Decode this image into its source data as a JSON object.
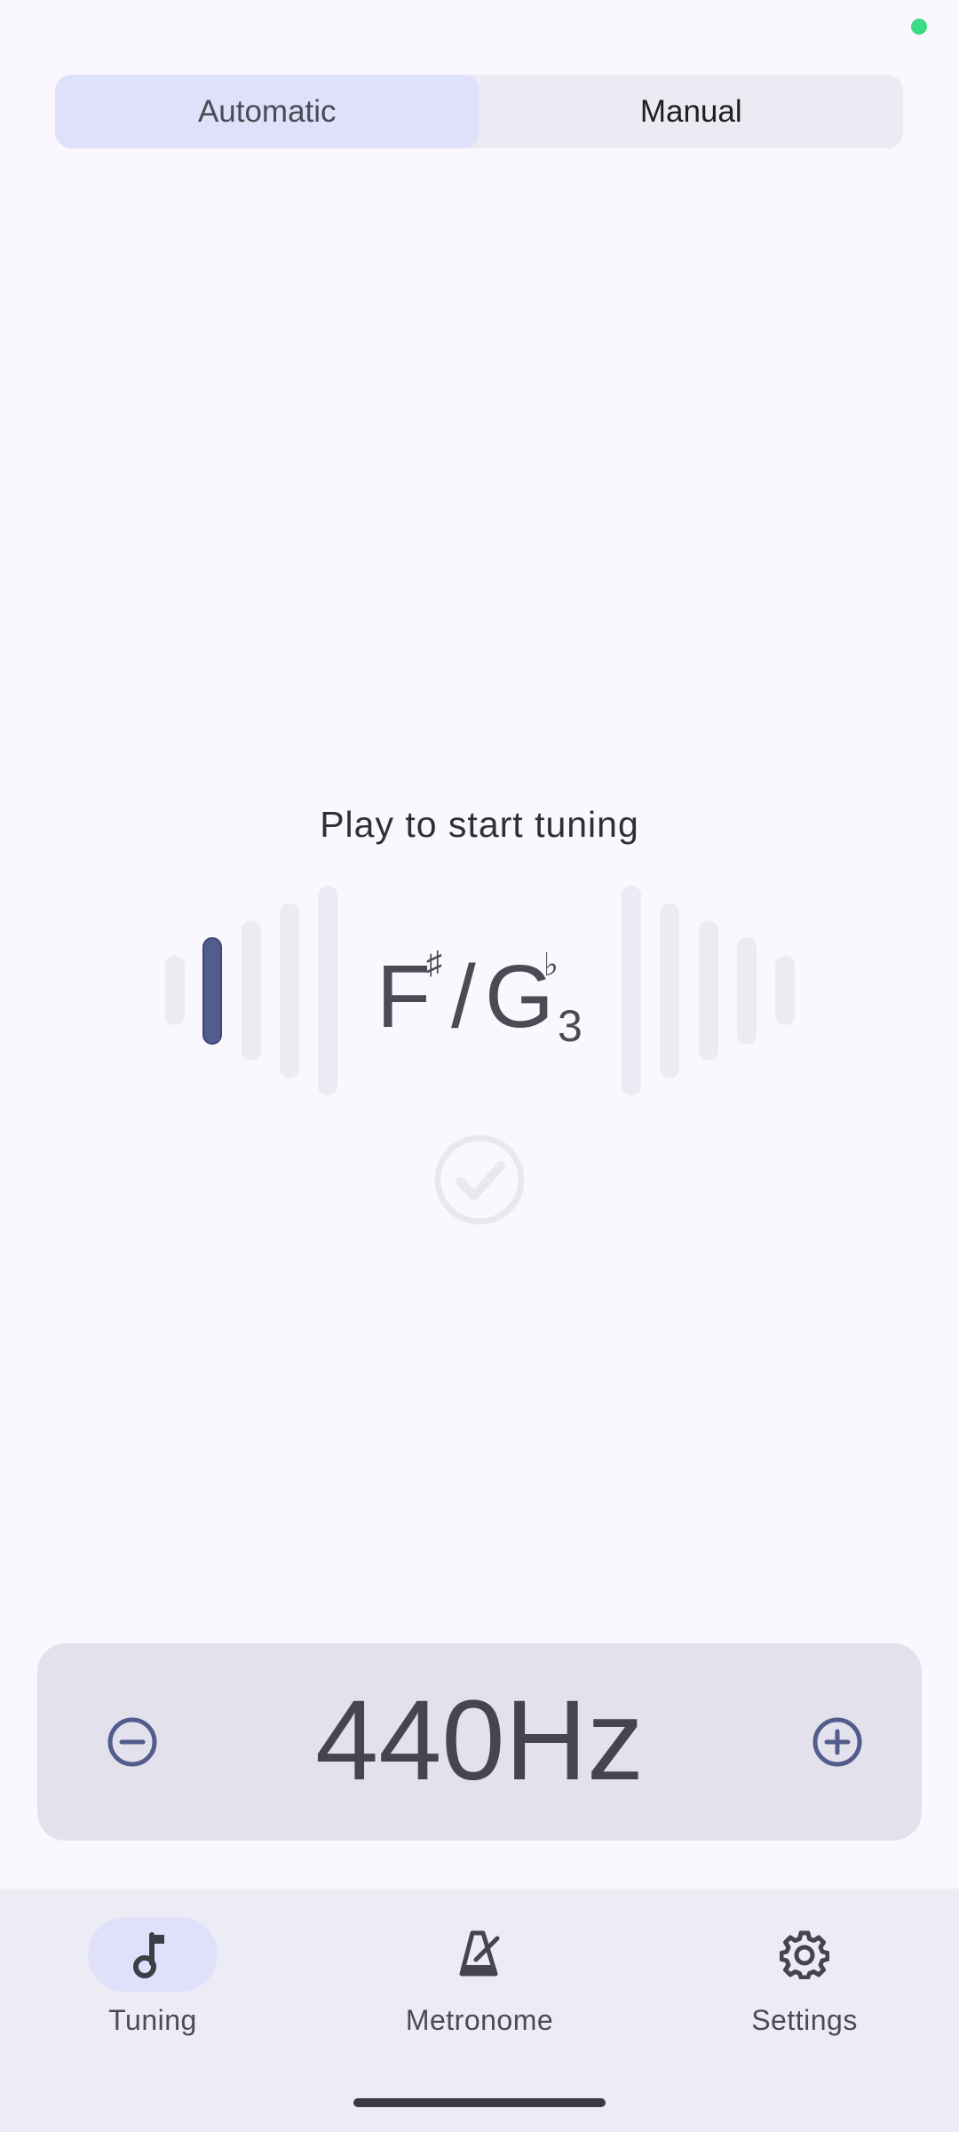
{
  "mode_toggle": {
    "options": [
      {
        "label": "Automatic",
        "selected": true
      },
      {
        "label": "Manual",
        "selected": false
      }
    ]
  },
  "tuner": {
    "prompt": "Play to start tuning",
    "note": {
      "first": "F",
      "first_accidental": "♯",
      "separator": "/",
      "second": "G",
      "second_accidental": "♭",
      "octave": "3"
    },
    "in_tune": false
  },
  "reference": {
    "frequency_label": "440Hz"
  },
  "bottom_nav": {
    "items": [
      {
        "label": "Tuning",
        "icon": "music-note-icon",
        "active": true
      },
      {
        "label": "Metronome",
        "icon": "metronome-icon",
        "active": false
      },
      {
        "label": "Settings",
        "icon": "gear-icon",
        "active": false
      }
    ]
  },
  "colors": {
    "accent": "#535d8d",
    "active_pill": "#dfe1fa",
    "status_dot": "#3ddc84"
  }
}
